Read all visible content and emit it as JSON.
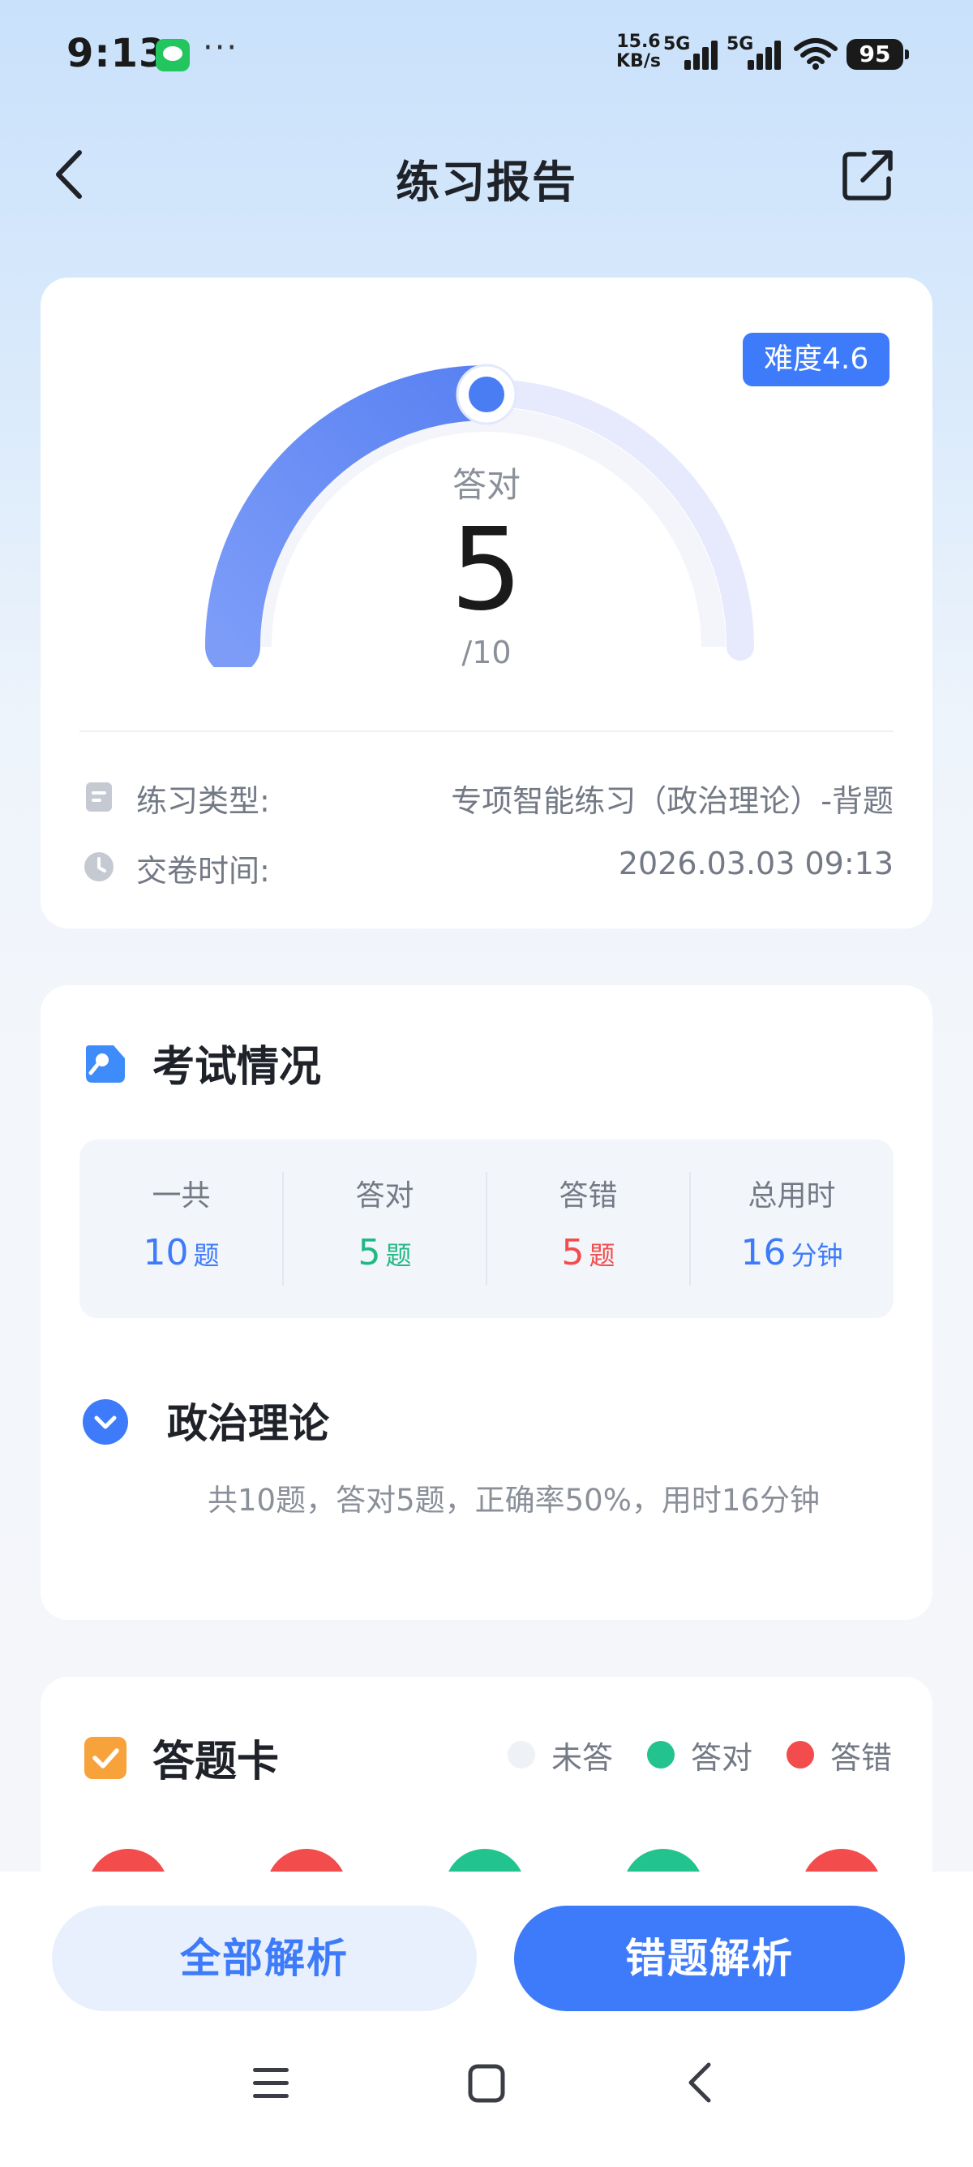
{
  "status_bar": {
    "time": "9:13",
    "dots": "···",
    "net_speed_value": "15.6",
    "net_speed_unit": "KB/s",
    "sim1": "5G",
    "sim2": "5G",
    "battery": "95"
  },
  "header": {
    "title": "练习报告",
    "icons": {
      "back": "chevron-left-icon",
      "share": "share-icon"
    }
  },
  "score": {
    "label": "答对",
    "correct": 5,
    "total_text": "/10",
    "difficulty": "难度4.6",
    "practice_type_label": "练习类型:",
    "practice_type_value": "专项智能练习（政治理论）-背题",
    "submit_time_label": "交卷时间:",
    "submit_time_value": "2026.03.03 09:13"
  },
  "exam": {
    "title": "考试情况",
    "stats": [
      {
        "label": "一共",
        "value": "10",
        "unit": "题",
        "color": "#3e7bfa"
      },
      {
        "label": "答对",
        "value": "5",
        "unit": "题",
        "color": "#22b884"
      },
      {
        "label": "答错",
        "value": "5",
        "unit": "题",
        "color": "#f24c4c"
      },
      {
        "label": "总用时",
        "value": "16",
        "unit": "分钟",
        "color": "#3e7bfa"
      }
    ],
    "subject_title": "政治理论",
    "subject_summary": "共10题，答对5题，正确率50%，用时16分钟"
  },
  "answer_card": {
    "title": "答题卡",
    "legend": [
      {
        "label": "未答",
        "color": "#eef1f5"
      },
      {
        "label": "答对",
        "color": "#22c38e"
      },
      {
        "label": "答错",
        "color": "#f24c4c"
      }
    ],
    "questions": [
      "wrong",
      "wrong",
      "correct",
      "correct",
      "wrong"
    ]
  },
  "actions": {
    "all_analysis": "全部解析",
    "wrong_analysis": "错题解析"
  },
  "colors": {
    "accent": "#3e7bfa",
    "correct": "#22c38e",
    "wrong": "#f24c4c"
  }
}
